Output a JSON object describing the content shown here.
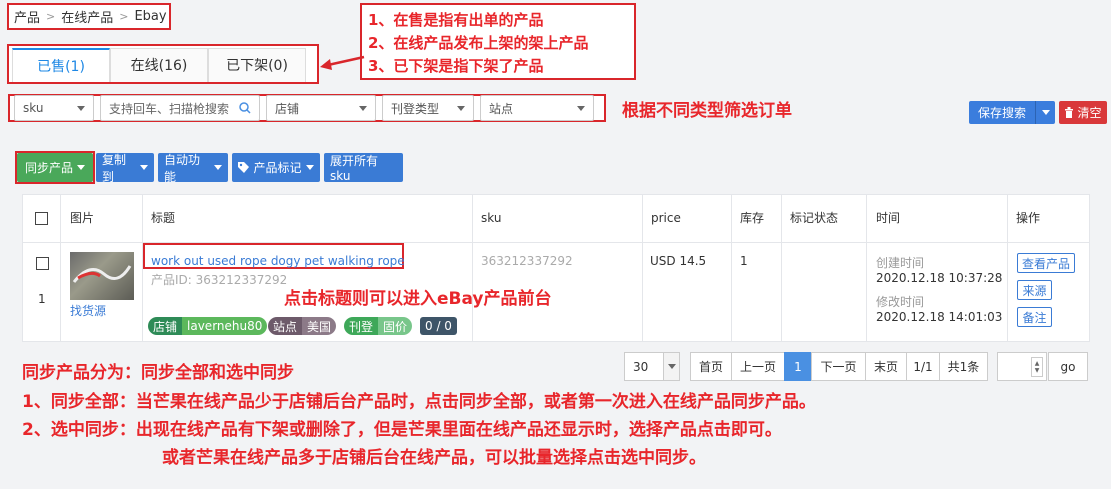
{
  "breadcrumb": {
    "items": [
      "产品",
      "在线产品",
      "Ebay"
    ]
  },
  "annotations": {
    "top": [
      "1、在售是指有出单的产品",
      "2、在线产品发布上架的架上产品",
      "3、已下架是指下架了产品"
    ],
    "filter": "根据不同类型筛选订单",
    "title_hint": "点击标题则可以进入eBay产品前台",
    "sync_title": "同步产品分为：同步全部和选中同步",
    "sync_1": "1、同步全部：当芒果在线产品少于店铺后台产品时，点击同步全部，或者第一次进入在线产品同步产品。",
    "sync_2": "2、选中同步：出现在线产品有下架或删除了，但是芒果里面在线产品还显示时，选择产品点击即可。",
    "sync_3": "或者芒果在线产品多于店铺后台在线产品，可以批量选择点击选中同步。"
  },
  "tabs": [
    {
      "label": "已售(1)",
      "active": true
    },
    {
      "label": "在线(16)",
      "active": false
    },
    {
      "label": "已下架(0)",
      "active": false
    }
  ],
  "filters": {
    "sku": "sku",
    "search_placeholder": "支持回车、扫描枪搜索",
    "store": "店铺",
    "listing_type": "刊登类型",
    "site": "站点"
  },
  "buttons": {
    "save_search": "保存搜索",
    "clear": "清空",
    "sync_products": "同步产品",
    "copy_to": "复制到",
    "auto_function": "自动功能",
    "product_mark": "产品标记",
    "expand_sku": "展开所有sku"
  },
  "table": {
    "headers": [
      "图片",
      "标题",
      "sku",
      "price",
      "库存",
      "标记状态",
      "时间",
      "操作"
    ],
    "row": {
      "index": "1",
      "find_source": "找货源",
      "title": "work out used rope dogy pet walking rope",
      "product_id": "产品ID: 363212337292",
      "sku": "363212337292",
      "price": "USD 14.5",
      "stock": "1",
      "created_label": "创建时间",
      "created": "2020.12.18 10:37:28",
      "modified_label": "修改时间",
      "modified": "2020.12.18 14:01:03",
      "tags": {
        "store_label": "店铺",
        "store_value": "lavernehu80",
        "site_label": "站点",
        "site_value": "美国",
        "listing_label": "刊登",
        "listing_value": "固价",
        "count": "0 / 0"
      },
      "ops": [
        "查看产品",
        "来源",
        "备注"
      ]
    }
  },
  "pagination": {
    "page_size": "30",
    "first": "首页",
    "prev": "上一页",
    "current": "1",
    "next": "下一页",
    "last": "末页",
    "page_info": "1/1",
    "total": "共1条",
    "go": "go"
  },
  "colors": {
    "accent": "#1e88e5",
    "annotation": "#e8262b",
    "green_button": "#4aa85a",
    "blue_button": "#3a7bd5"
  }
}
